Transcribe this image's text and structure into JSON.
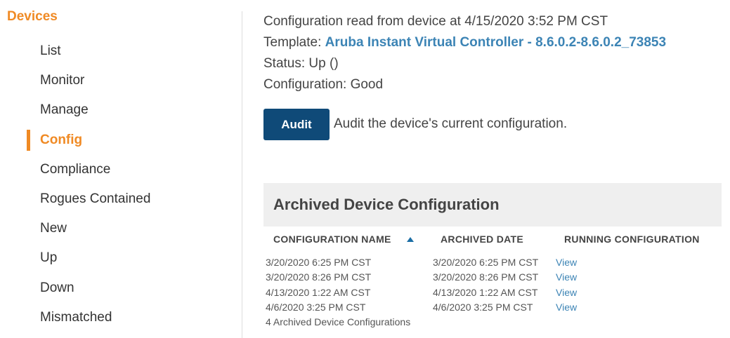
{
  "sidebar": {
    "title": "Devices",
    "items": [
      {
        "label": "List"
      },
      {
        "label": "Monitor"
      },
      {
        "label": "Manage"
      },
      {
        "label": "Config"
      },
      {
        "label": "Compliance"
      },
      {
        "label": "Rogues Contained"
      },
      {
        "label": "New"
      },
      {
        "label": "Up"
      },
      {
        "label": "Down"
      },
      {
        "label": "Mismatched"
      }
    ],
    "active_item": "Config"
  },
  "main": {
    "config_read": "Configuration read from device at 4/15/2020 3:52 PM CST",
    "template_label": "Template:",
    "template_link": "Aruba Instant Virtual Controller - 8.6.0.2-8.6.0.2_73853",
    "status": "Status: Up ()",
    "configuration": "Configuration: Good",
    "audit_button": "Audit",
    "audit_description": "Audit the device's current configuration."
  },
  "archive": {
    "title": "Archived Device Configuration",
    "columns": {
      "name": "CONFIGURATION NAME",
      "date": "ARCHIVED DATE",
      "running": "RUNNING CONFIGURATION"
    },
    "sort_icon": "sort-ascending-icon",
    "rows": [
      {
        "name": "3/20/2020 6:25 PM CST",
        "date": "3/20/2020 6:25 PM CST",
        "view": "View"
      },
      {
        "name": "3/20/2020 8:26 PM CST",
        "date": "3/20/2020 8:26 PM CST",
        "view": "View"
      },
      {
        "name": "4/13/2020 1:22 AM CST",
        "date": "4/13/2020 1:22 AM CST",
        "view": "View"
      },
      {
        "name": "4/6/2020 3:25 PM CST",
        "date": "4/6/2020 3:25 PM CST",
        "view": "View"
      }
    ],
    "count": "4 Archived Device Configurations"
  },
  "colors": {
    "accent_orange": "#f08a24",
    "button_navy": "#0f4a78",
    "link_blue": "#3c84b5",
    "panel_gray": "#efefef"
  }
}
